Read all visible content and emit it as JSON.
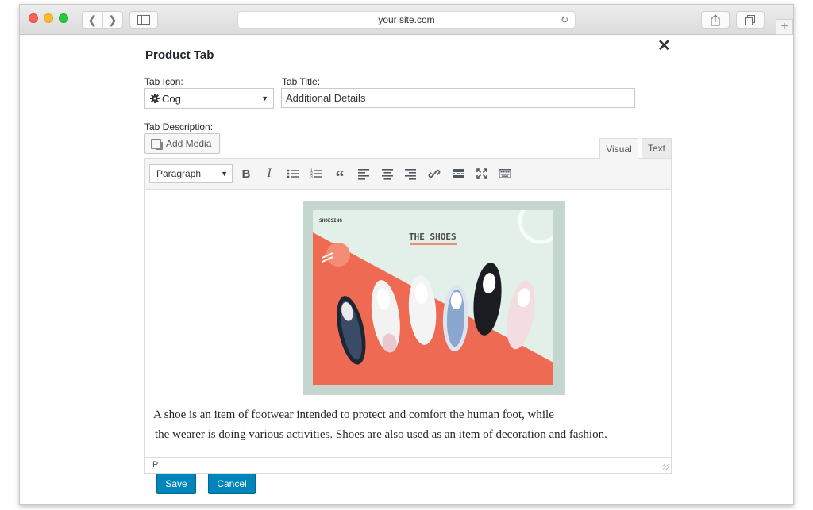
{
  "browser": {
    "url": "your site.com"
  },
  "dialog": {
    "title": "Product Tab",
    "close_symbol": "✕",
    "tab_icon": {
      "label": "Tab Icon:",
      "selected": "Cog",
      "icon": "cog-icon"
    },
    "tab_title": {
      "label": "Tab Title:",
      "value": "Additional Details"
    },
    "tab_description": {
      "label": "Tab Description:"
    },
    "add_media_label": "Add Media",
    "editor_tabs": {
      "visual": "Visual",
      "text": "Text"
    },
    "toolbar": {
      "format": "Paragraph",
      "buttons": [
        "bold",
        "italic",
        "bullet-list",
        "numbered-list",
        "blockquote",
        "align-left",
        "align-center",
        "align-right",
        "link",
        "read-more",
        "fullscreen",
        "toolbar-toggle"
      ]
    },
    "image": {
      "brand": "SHOESING",
      "heading": "THE SHOES",
      "colors": {
        "frame": "#c4d6cd",
        "panel": "#e3efe9",
        "coral": "#ef6a52"
      }
    },
    "content": {
      "line1": "A shoe is an item of footwear intended to protect and comfort the human foot, while",
      "line2": "the wearer is doing  various activities. Shoes are also used as an item of decoration and fashion."
    },
    "status_path": "P",
    "save_label": "Save",
    "cancel_label": "Cancel"
  },
  "colors": {
    "primary_button": "#0085ba"
  }
}
